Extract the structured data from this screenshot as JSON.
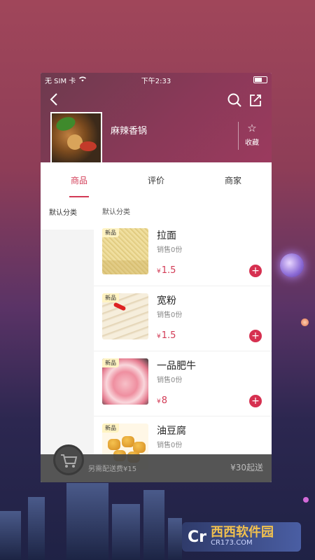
{
  "status_bar": {
    "carrier": "无 SIM 卡",
    "time": "下午2:33"
  },
  "store": {
    "name": "麻辣香锅",
    "favorite_label": "收藏"
  },
  "tabs": [
    {
      "label": "商品",
      "active": true
    },
    {
      "label": "评价",
      "active": false
    },
    {
      "label": "商家",
      "active": false
    }
  ],
  "sidebar": {
    "items": [
      {
        "label": "默认分类"
      }
    ]
  },
  "category_title": "默认分类",
  "items": [
    {
      "badge": "新品",
      "name": "拉面",
      "sales": "销售0份",
      "price": "1.5",
      "currency": "¥"
    },
    {
      "badge": "新品",
      "name": "宽粉",
      "sales": "销售0份",
      "price": "1.5",
      "currency": "¥"
    },
    {
      "badge": "新品",
      "name": "一品肥牛",
      "sales": "销售0份",
      "price": "8",
      "currency": "¥"
    },
    {
      "badge": "新品",
      "name": "油豆腐",
      "sales": "销售0份",
      "price": "",
      "currency": ""
    }
  ],
  "cart": {
    "delivery_fee": "另需配送费¥15",
    "min_order": "¥30起送"
  },
  "watermark": {
    "cn": "西西软件园",
    "en": "CR173.COM"
  },
  "colors": {
    "accent": "#d23a55",
    "header": "#8a3958"
  },
  "icons": [
    "back-icon",
    "search-icon",
    "share-icon",
    "star-icon",
    "plus-icon",
    "cart-icon",
    "wifi-icon",
    "battery-icon"
  ]
}
